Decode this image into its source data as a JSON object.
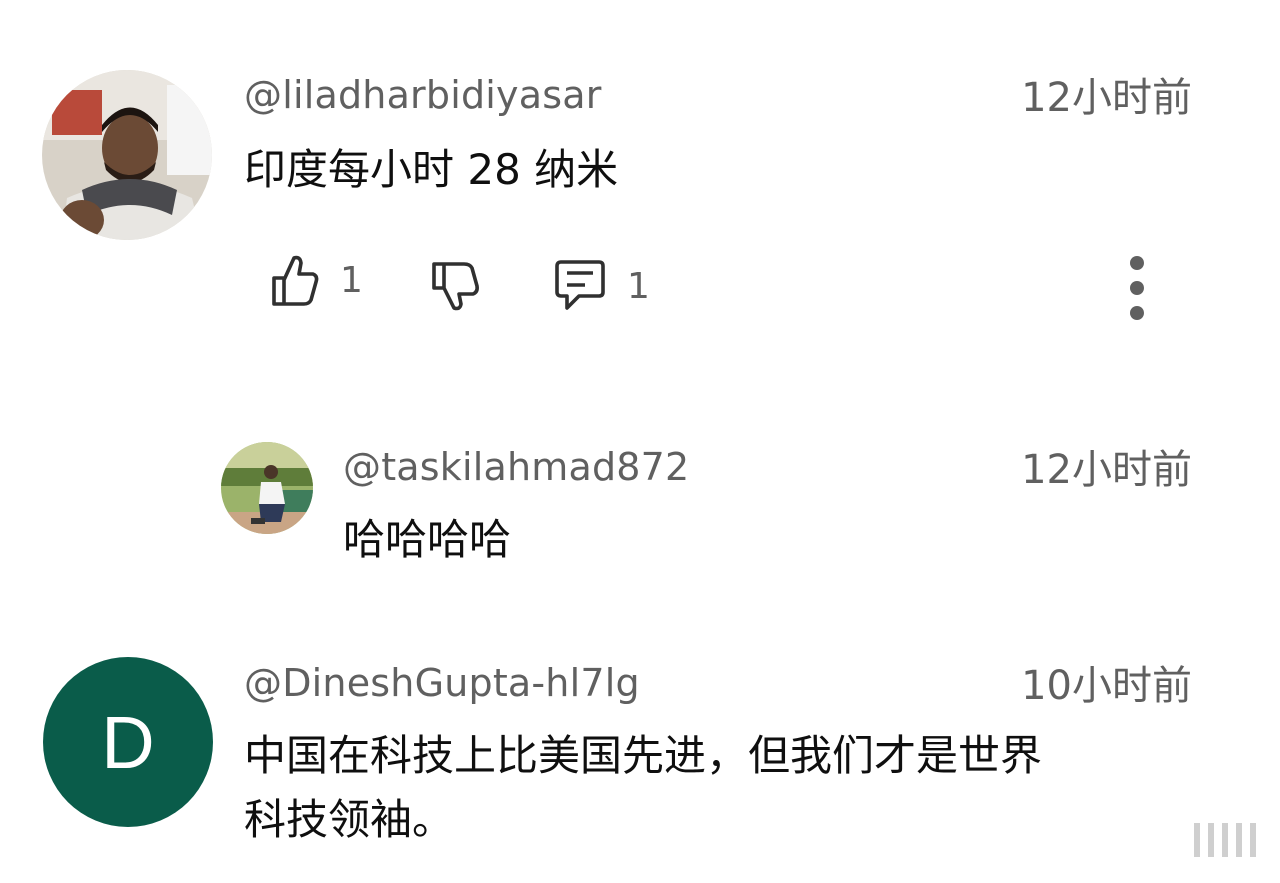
{
  "comments": [
    {
      "username": "@liladharbidiyasar",
      "time": "12小时前",
      "text": "印度每小时 28 纳米",
      "likes": "1",
      "replies": "1",
      "avatar_icon": "user-photo-avatar"
    },
    {
      "username": "@taskilahmad872",
      "time": "12小时前",
      "text": "哈哈哈哈",
      "avatar_icon": "user-photo-avatar"
    },
    {
      "username": "@DineshGupta-hl7lg",
      "time": "10小时前",
      "text_line1": "中国在科技上比美国先进，但我们才是世界",
      "text_line2": "科技领袖。",
      "avatar_letter": "D",
      "avatar_color": "#0a5c4a"
    }
  ],
  "icons": {
    "like": "thumbs-up-icon",
    "dislike": "thumbs-down-icon",
    "reply": "comment-icon",
    "more": "more-vertical-icon"
  }
}
